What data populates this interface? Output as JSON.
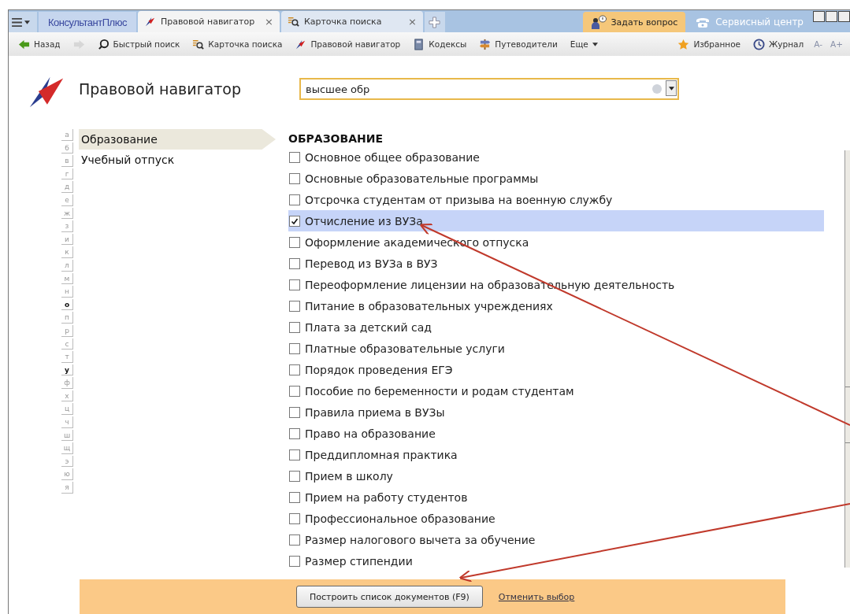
{
  "tabs": [
    {
      "label": "Правовой навигатор",
      "selected": true,
      "kind": "navigator",
      "close": "×"
    },
    {
      "label": "Карточка поиска",
      "selected": false,
      "kind": "card",
      "close": "×"
    }
  ],
  "brand": "КонсультантПлюс",
  "header_buttons": [
    {
      "label": "Задать вопрос",
      "kind": "ask"
    },
    {
      "label": "Сервисный центр",
      "kind": "service"
    }
  ],
  "toolbar": {
    "left": [
      {
        "label": "Назад",
        "kind": "back",
        "disabled": false
      },
      {
        "kind": "forward",
        "disabled": true
      },
      {
        "label": "Быстрый поиск",
        "kind": "search",
        "disabled": false
      },
      {
        "label": "Карточка поиска",
        "kind": "card",
        "disabled": false
      },
      {
        "label": "Правовой навигатор",
        "kind": "navigator",
        "disabled": false
      },
      {
        "label": "Кодексы",
        "kind": "book",
        "disabled": false
      },
      {
        "label": "Путеводители",
        "kind": "signpost",
        "disabled": false
      },
      {
        "label": "Еще",
        "kind": "more",
        "disabled": false
      }
    ],
    "right": [
      {
        "label": "Избранное",
        "kind": "star"
      },
      {
        "label": "Журнал",
        "kind": "clock"
      },
      {
        "label": "A-",
        "kind": "text"
      },
      {
        "label": "A+",
        "kind": "text"
      }
    ]
  },
  "page_title": "Правовой навигатор",
  "search": {
    "value": "высшее обр"
  },
  "alphabet": [
    {
      "letter": "а",
      "active": false
    },
    {
      "letter": "б",
      "active": false
    },
    {
      "letter": "в",
      "active": false
    },
    {
      "letter": "г",
      "active": false
    },
    {
      "letter": "д",
      "active": false
    },
    {
      "letter": "е",
      "active": false
    },
    {
      "letter": "ж",
      "active": false
    },
    {
      "letter": "з",
      "active": false
    },
    {
      "letter": "и",
      "active": false
    },
    {
      "letter": "к",
      "active": false
    },
    {
      "letter": "л",
      "active": false
    },
    {
      "letter": "м",
      "active": false
    },
    {
      "letter": "н",
      "active": false
    },
    {
      "letter": "о",
      "active": true
    },
    {
      "letter": "п",
      "active": false
    },
    {
      "letter": "р",
      "active": false
    },
    {
      "letter": "с",
      "active": false
    },
    {
      "letter": "т",
      "active": false
    },
    {
      "letter": "у",
      "active": true
    },
    {
      "letter": "ф",
      "active": false
    },
    {
      "letter": "х",
      "active": false
    },
    {
      "letter": "ц",
      "active": false
    },
    {
      "letter": "ч",
      "active": false
    },
    {
      "letter": "ш",
      "active": false
    },
    {
      "letter": "щ",
      "active": false
    },
    {
      "letter": "э",
      "active": false
    },
    {
      "letter": "ю",
      "active": false
    },
    {
      "letter": "я",
      "active": false
    }
  ],
  "categories": [
    {
      "label": "Образование",
      "selected": true
    },
    {
      "label": "Учебный отпуск",
      "selected": false
    }
  ],
  "section_heading": "ОБРАЗОВАНИЕ",
  "items": [
    {
      "label": "Основное общее образование",
      "checked": false
    },
    {
      "label": "Основные образовательные программы",
      "checked": false
    },
    {
      "label": "Отсрочка студентам от призыва на военную службу",
      "checked": false
    },
    {
      "label": "Отчисление из ВУЗа",
      "checked": true
    },
    {
      "label": "Оформление академического отпуска",
      "checked": false
    },
    {
      "label": "Перевод из ВУЗа в ВУЗ",
      "checked": false
    },
    {
      "label": "Переоформление лицензии на образовательную деятельность",
      "checked": false
    },
    {
      "label": "Питание в образовательных учреждениях",
      "checked": false
    },
    {
      "label": "Плата за детский сад",
      "checked": false
    },
    {
      "label": "Платные образовательные услуги",
      "checked": false
    },
    {
      "label": "Порядок проведения ЕГЭ",
      "checked": false
    },
    {
      "label": "Пособие по беременности и родам студентам",
      "checked": false
    },
    {
      "label": "Правила приема в ВУЗы",
      "checked": false
    },
    {
      "label": "Право на образование",
      "checked": false
    },
    {
      "label": "Преддипломная практика",
      "checked": false
    },
    {
      "label": "Прием в школу",
      "checked": false
    },
    {
      "label": "Прием на работу студентов",
      "checked": false
    },
    {
      "label": "Профессиональное образование",
      "checked": false
    },
    {
      "label": "Размер налогового вычета за обучение",
      "checked": false
    },
    {
      "label": "Размер стипендии",
      "checked": false
    }
  ],
  "footer": {
    "button": "Построить список документов (F9)",
    "link": "Отменить выбор"
  }
}
